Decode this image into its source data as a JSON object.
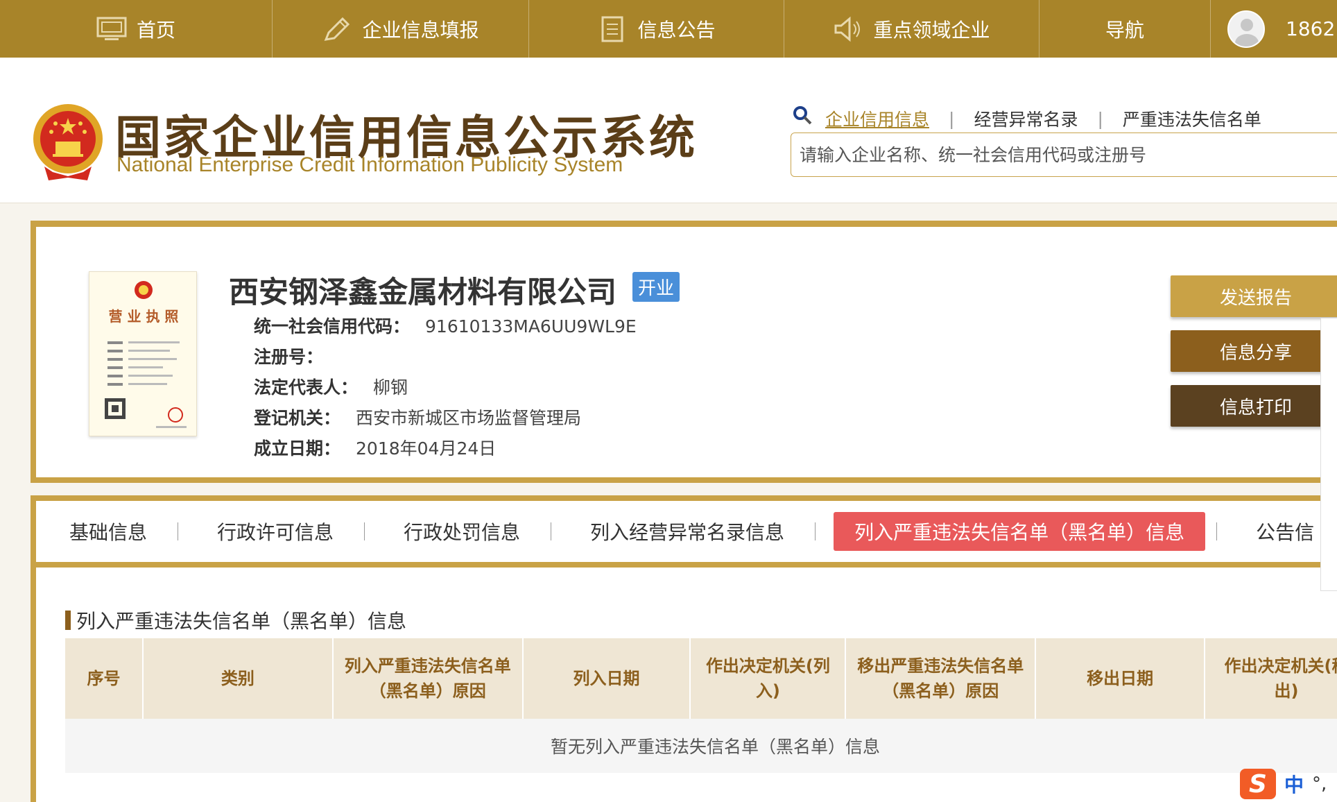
{
  "nav": {
    "items": [
      {
        "label": "首页",
        "icon": "monitor-icon"
      },
      {
        "label": "企业信息填报",
        "icon": "pen-icon"
      },
      {
        "label": "信息公告",
        "icon": "document-icon"
      },
      {
        "label": "重点领域企业",
        "icon": "speaker-icon"
      },
      {
        "label": "导航",
        "icon": ""
      }
    ],
    "user_phone": "1862"
  },
  "header": {
    "title": "国家企业信用信息公示系统",
    "subtitle": "National Enterprise Credit Information Publicity System",
    "search_links": [
      "企业信用信息",
      "经营异常名录",
      "严重违法失信名单"
    ],
    "search_placeholder": "请输入企业名称、统一社会信用代码或注册号"
  },
  "company": {
    "license_caption": "营 业 执 照",
    "name": "西安钢泽鑫金属材料有限公司",
    "status": "开业",
    "fields": [
      {
        "label": "统一社会信用代码：",
        "value": "91610133MA6UU9WL9E"
      },
      {
        "label": "注册号：",
        "value": ""
      },
      {
        "label": "法定代表人：",
        "value": "柳钢"
      },
      {
        "label": "登记机关：",
        "value": "西安市新城区市场监督管理局"
      },
      {
        "label": "成立日期：",
        "value": "2018年04月24日"
      }
    ],
    "buttons": {
      "send": "发送报告",
      "share": "信息分享",
      "print": "信息打印"
    }
  },
  "tabs": [
    {
      "label": "基础信息",
      "active": false
    },
    {
      "label": "行政许可信息",
      "active": false
    },
    {
      "label": "行政处罚信息",
      "active": false
    },
    {
      "label": "列入经营异常名录信息",
      "active": false
    },
    {
      "label": "列入严重违法失信名单（黑名单）信息",
      "active": true
    },
    {
      "label": "公告信",
      "active": false
    }
  ],
  "section": {
    "title": "列入严重违法失信名单（黑名单）信息",
    "columns": [
      "序号",
      "类别",
      "列入严重违法失信名单（黑名单）原因",
      "列入日期",
      "作出决定机关(列入)",
      "移出严重违法失信名单（黑名单）原因",
      "移出日期",
      "作出决定机关(移出)"
    ],
    "empty_text": "暂无列入严重违法失信名单（黑名单）信息"
  },
  "ime": {
    "logo": "S",
    "mode": "中",
    "punct": "°,"
  },
  "colors": {
    "brand": "#a88429",
    "accent_red": "#e9595a",
    "badge_blue": "#4a8fd9"
  }
}
